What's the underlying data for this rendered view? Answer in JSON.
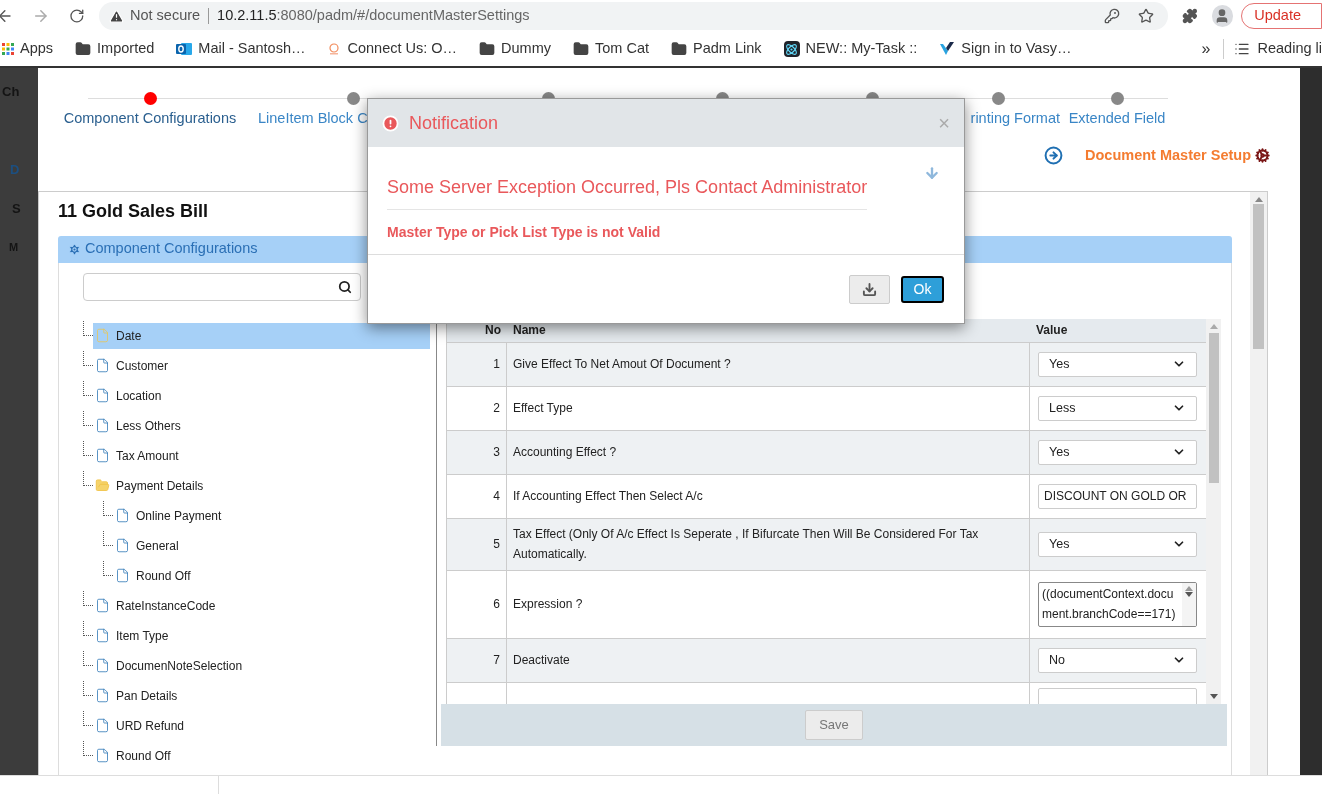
{
  "address_bar": {
    "security": "Not secure",
    "url_host": "10.2.11.5",
    "url_rest": ":8080/padm/#/documentMasterSettings"
  },
  "update_button": "Update",
  "bookmarks": [
    {
      "kind": "apps",
      "label": "Apps"
    },
    {
      "kind": "folder",
      "label": "Imported"
    },
    {
      "kind": "mail",
      "label": "Mail - Santosh…"
    },
    {
      "kind": "site",
      "label": "Connect Us: O…"
    },
    {
      "kind": "folder",
      "label": "Dummy"
    },
    {
      "kind": "folder",
      "label": "Tom Cat"
    },
    {
      "kind": "folder",
      "label": "Padm Link"
    },
    {
      "kind": "react",
      "label": "NEW:: My-Task ::"
    },
    {
      "kind": "vasy",
      "label": "Sign in to Vasy…"
    }
  ],
  "bookmarks_overflow": "»",
  "reading_list": "Reading li",
  "backdrop_fragments": [
    "Ch",
    "D",
    "S",
    "M"
  ],
  "stepper": {
    "steps": [
      {
        "label": "Component Configurations",
        "selected": true
      },
      {
        "label": "LineItem Block C",
        "selected": false
      },
      {
        "selected": false
      },
      {
        "selected": false
      },
      {
        "selected": false
      },
      {
        "label": "rinting Format",
        "selected": false
      },
      {
        "label": "Extended Field",
        "selected": false
      }
    ]
  },
  "setup_link": "Document Master Setup",
  "document_title": "11 Gold Sales Bill",
  "section_header": "Component Configurations",
  "tree": {
    "items": [
      {
        "label": "Date",
        "selected": true
      },
      {
        "label": "Customer",
        "selected": false
      },
      {
        "label": "Location",
        "selected": false
      },
      {
        "label": "Less Others",
        "selected": false
      },
      {
        "label": "Tax Amount",
        "selected": false
      },
      {
        "label": "Payment Details",
        "selected": false,
        "expanded": true,
        "children": [
          {
            "label": "Online Payment",
            "selected": false
          },
          {
            "label": "General",
            "selected": false
          },
          {
            "label": "Round Off",
            "selected": false
          }
        ]
      },
      {
        "label": "RateInstanceCode",
        "selected": false
      },
      {
        "label": "Item Type",
        "selected": false
      },
      {
        "label": "DocumenNoteSelection",
        "selected": false
      },
      {
        "label": "Pan Details",
        "selected": false
      },
      {
        "label": "URD Refund",
        "selected": false
      },
      {
        "label": "Round Off",
        "selected": false
      }
    ]
  },
  "table": {
    "columns": [
      "No",
      "Name",
      "Value"
    ],
    "rows": [
      {
        "no": "1",
        "name": "Give Effect To Net Amout Of Document ?",
        "kind": "select",
        "value": "Yes"
      },
      {
        "no": "2",
        "name": "Effect Type",
        "kind": "select",
        "value": "Less"
      },
      {
        "no": "3",
        "name": "Accounting Effect ?",
        "kind": "select",
        "value": "Yes"
      },
      {
        "no": "4",
        "name": "If Accounting Effect Then Select A/c",
        "kind": "input",
        "value": "DISCOUNT ON GOLD OR"
      },
      {
        "no": "5",
        "name": "Tax Effect (Only Of A/c Effect Is Seperate , If Bifurcate Then Will Be Considered For Tax Automatically.",
        "kind": "select",
        "value": "Yes"
      },
      {
        "no": "6",
        "name": "Expression ?",
        "kind": "textarea",
        "value": "((documentContext.document.branchCode==171)"
      },
      {
        "no": "7",
        "name": "Deactivate",
        "kind": "select",
        "value": "No"
      },
      {
        "kind": "input"
      }
    ]
  },
  "save_button": {
    "label": "Save",
    "disabled": true
  },
  "dialog": {
    "title": "Notification",
    "close": "×",
    "message": "Some Server Exception Occurred, Pls Contact Administrator",
    "detail": "Master Type or Pick List Type is not Valid",
    "ok_button": "Ok"
  }
}
